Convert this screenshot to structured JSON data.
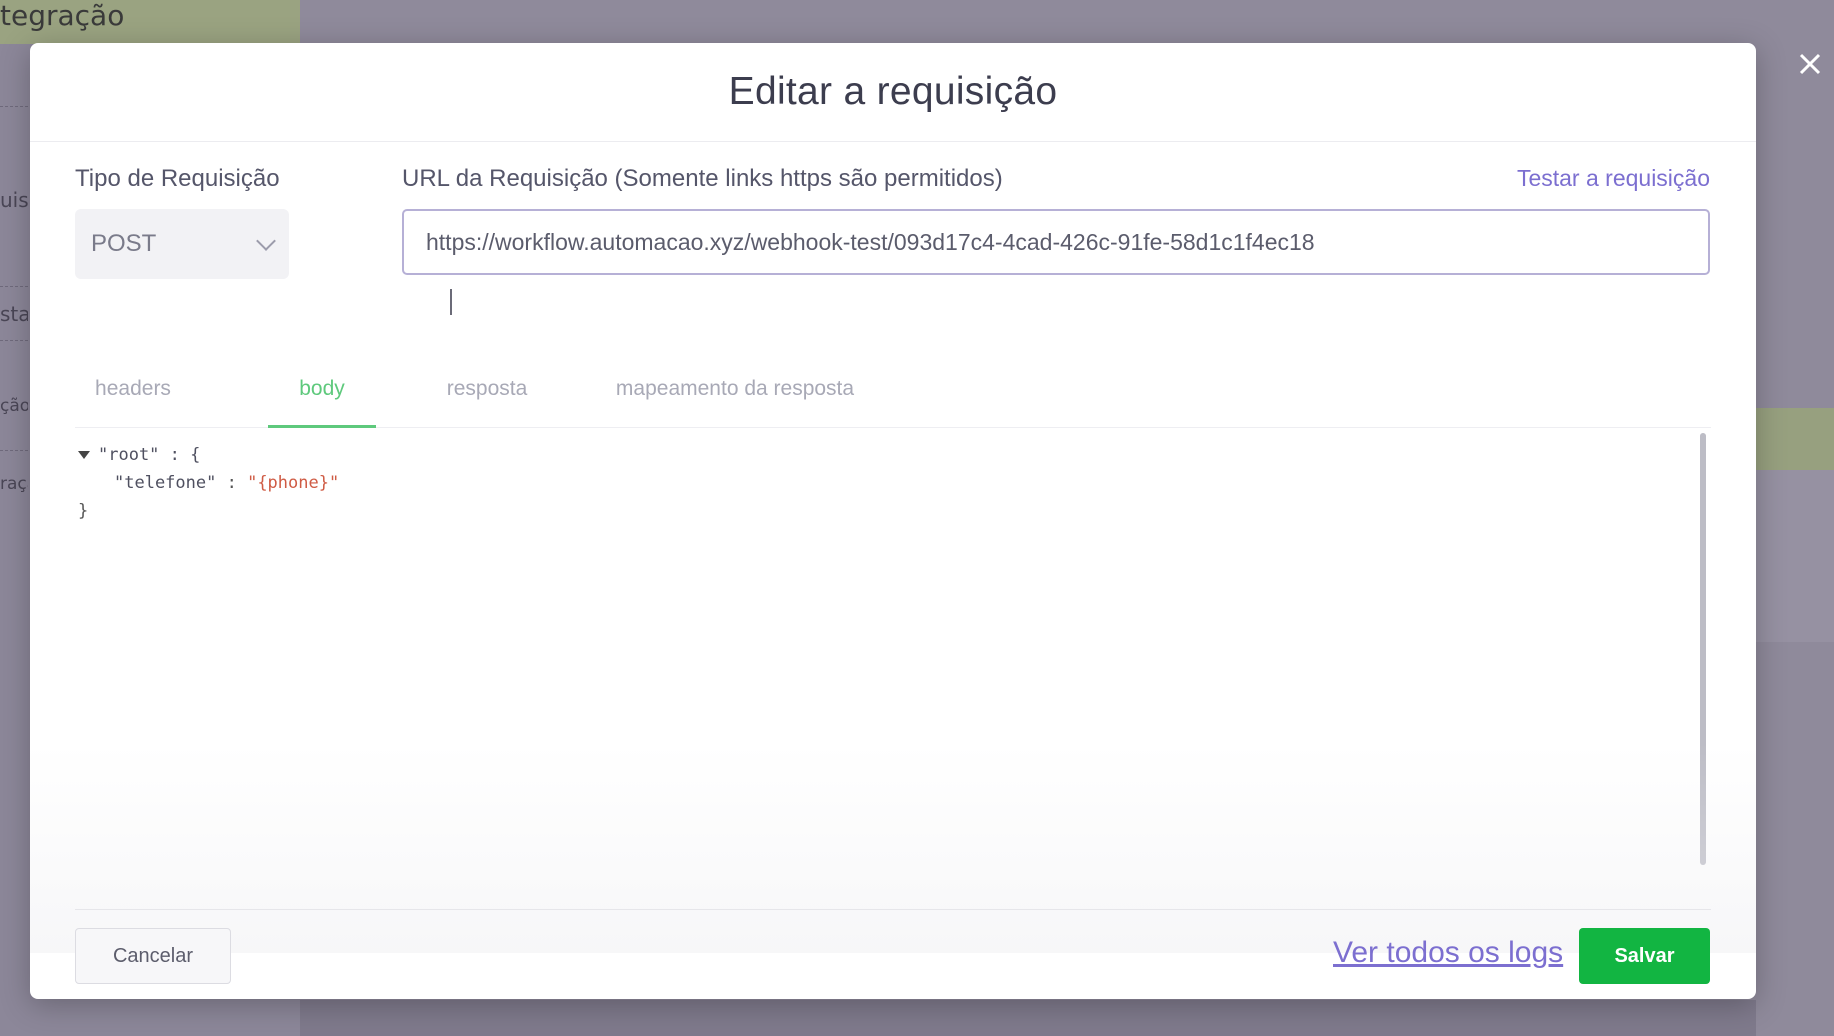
{
  "background": {
    "header_text": "tegração",
    "side_items": [
      "uisi",
      "sta",
      "ção",
      "raçã"
    ]
  },
  "modal": {
    "title": "Editar a requisição",
    "request_type": {
      "label": "Tipo de Requisição",
      "value": "POST"
    },
    "url": {
      "label": "URL da Requisição (Somente links https são permitidos)",
      "value": "https://workflow.automacao.xyz/webhook-test/093d17c4-4cad-426c-91fe-58d1c1f4ec18",
      "test_link": "Testar a requisição"
    },
    "tabs": [
      {
        "label": "headers",
        "active": false
      },
      {
        "label": "body",
        "active": true
      },
      {
        "label": "resposta",
        "active": false
      },
      {
        "label": "mapeamento da resposta",
        "active": false
      }
    ],
    "json_body": {
      "root_line": "\"root\" : {",
      "key": "\"telefone\"",
      "separator": " : ",
      "value": "\"{phone}\"",
      "close": "}"
    },
    "footer": {
      "cancel_label": "Cancelar",
      "logs_label": "Ver todos os logs",
      "save_label": "Salvar"
    }
  },
  "colors": {
    "accent": "#7c6fd0",
    "active_tab": "#5ec97c",
    "save": "#12b542",
    "json_string": "#cf5b44"
  },
  "icons": {
    "close": "close-icon",
    "dropdown": "chevron-down-icon",
    "collapse": "caret-down-icon"
  }
}
